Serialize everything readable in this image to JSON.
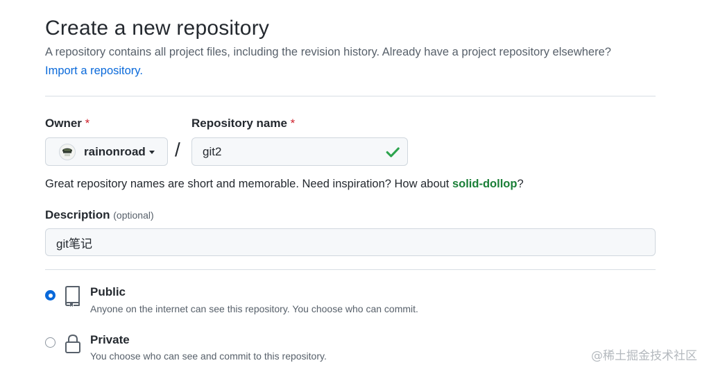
{
  "header": {
    "title": "Create a new repository",
    "subtitle": "A repository contains all project files, including the revision history. Already have a project repository elsewhere?",
    "import_link": "Import a repository."
  },
  "owner": {
    "label": "Owner",
    "required_mark": "*",
    "value": "rainonroad",
    "icon": "avatar"
  },
  "separator": "/",
  "repo_name": {
    "label": "Repository name",
    "required_mark": "*",
    "value": "git2",
    "status_icon": "check-icon",
    "status_color": "#2da44e"
  },
  "hint": {
    "prefix": "Great repository names are short and memorable. Need inspiration? How about ",
    "suggestion": "solid-dollop",
    "suffix": "?"
  },
  "description": {
    "label": "Description",
    "optional": "(optional)",
    "value": "git笔记"
  },
  "visibility": [
    {
      "label": "Public",
      "description": "Anyone on the internet can see this repository. You choose who can commit.",
      "icon": "repo-icon",
      "selected": true
    },
    {
      "label": "Private",
      "description": "You choose who can see and commit to this repository.",
      "icon": "lock-icon",
      "selected": false
    }
  ],
  "colors": {
    "link": "#0969da",
    "required": "#cf222e",
    "success": "#1a7f37",
    "radio_selected": "#0969da"
  },
  "watermark": "@稀土掘金技术社区"
}
